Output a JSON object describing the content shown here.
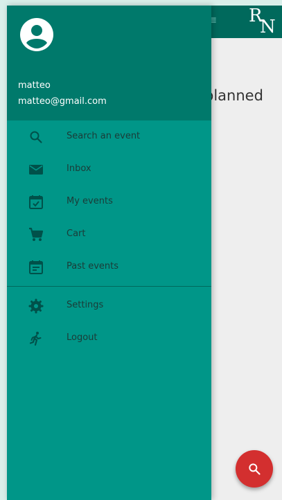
{
  "app": {
    "header_hint": "≡",
    "logo_r": "R",
    "logo_n": "N",
    "subtitle_fragment": "planned"
  },
  "drawer": {
    "user": {
      "name": "matteo",
      "email": "matteo@gmail.com"
    },
    "menu": [
      {
        "label": "Search an event",
        "icon": "search-icon"
      },
      {
        "label": "Inbox",
        "icon": "mail-icon"
      },
      {
        "label": "My events",
        "icon": "event-check-icon"
      },
      {
        "label": "Cart",
        "icon": "cart-icon"
      },
      {
        "label": "Past events",
        "icon": "event-note-icon"
      }
    ],
    "secondary_menu": [
      {
        "label": "Settings",
        "icon": "gear-icon"
      },
      {
        "label": "Logout",
        "icon": "running-person-icon"
      }
    ]
  },
  "colors": {
    "drawer_bg": "#009688",
    "drawer_header_bg": "#00796b",
    "app_header_bg": "#00695c",
    "fab_bg": "#d32f2f",
    "icon_color": "#00514a"
  }
}
